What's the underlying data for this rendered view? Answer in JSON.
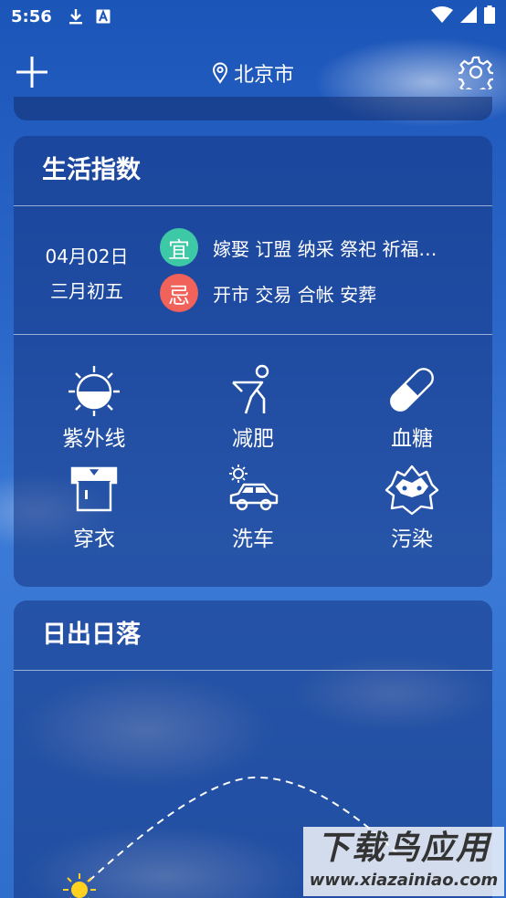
{
  "status_bar": {
    "time": "5:56"
  },
  "header": {
    "location": "北京市"
  },
  "life_index": {
    "title": "生活指数",
    "date": "04月02日",
    "lunar": "三月初五",
    "yi_badge": "宜",
    "yi_text": "嫁娶 订盟 纳采 祭祀 祈福…",
    "ji_badge": "忌",
    "ji_text": "开市 交易 合帐 安葬",
    "items": [
      {
        "label": "紫外线",
        "icon": "uv-icon"
      },
      {
        "label": "减肥",
        "icon": "exercise-icon"
      },
      {
        "label": "血糖",
        "icon": "pill-icon"
      },
      {
        "label": "穿衣",
        "icon": "clothing-icon"
      },
      {
        "label": "洗车",
        "icon": "car-wash-icon"
      },
      {
        "label": "污染",
        "icon": "pollution-icon"
      }
    ]
  },
  "sun_card": {
    "title": "日出日落"
  },
  "watermark": {
    "main": "下载鸟应用",
    "sub": "www.xiazainiao.com"
  },
  "colors": {
    "yi": "#3dc9a5",
    "ji": "#f0625a",
    "background": "#2a66c8"
  }
}
